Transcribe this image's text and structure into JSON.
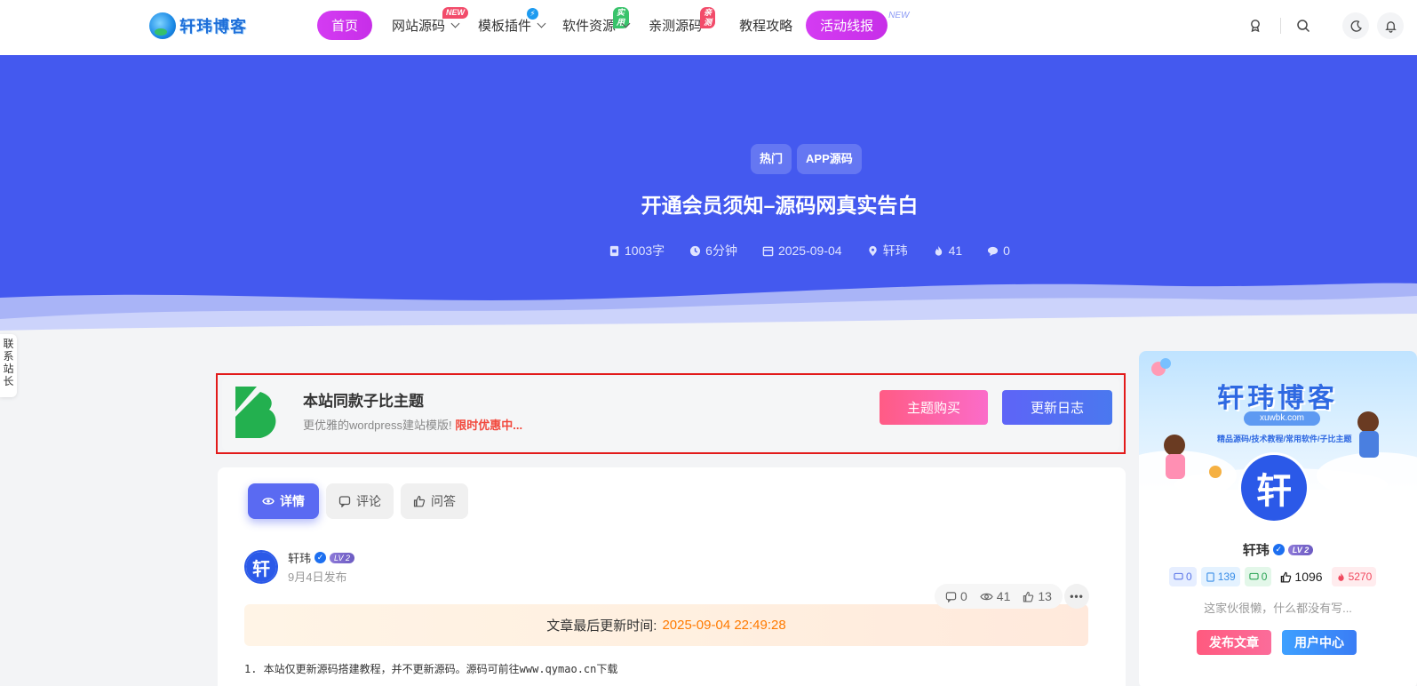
{
  "logo": {
    "text": "轩玮博客"
  },
  "nav": {
    "items": [
      {
        "label": "首页"
      },
      {
        "label": "网站源码",
        "badge": "NEW"
      },
      {
        "label": "模板插件",
        "badge": "⚡"
      },
      {
        "label": "软件资源",
        "badge": "实用"
      },
      {
        "label": "亲测源码",
        "badge": "亲测"
      },
      {
        "label": "教程攻略"
      },
      {
        "label": "活动线报",
        "badge": "NEW"
      }
    ]
  },
  "hero": {
    "tags": [
      "热门",
      "APP源码"
    ],
    "title": "开通会员须知–源码网真实告白",
    "meta": {
      "words": "1003字",
      "read_time": "6分钟",
      "date": "2025-09-04",
      "author": "轩玮",
      "views": "41",
      "comments": "0"
    }
  },
  "contact_tab": {
    "label": "联系站长"
  },
  "promo": {
    "title": "本站同款子比主题",
    "subtitle": "更优雅的wordpress建站模版!",
    "highlight": "限时优惠中...",
    "buy_label": "主题购买",
    "log_label": "更新日志"
  },
  "article": {
    "tabs": [
      "详情",
      "评论",
      "问答"
    ],
    "author": {
      "name": "轩玮",
      "level": "LV 2",
      "published": "9月4日发布",
      "avatar_char": "轩"
    },
    "stats": {
      "comments": "0",
      "views": "41",
      "likes": "13"
    },
    "update_label": "文章最后更新时间:",
    "update_time": "2025-09-04 22:49:28",
    "first_line": "1. 本站仅更新源码搭建教程，并不更新源码。源码可前往www.qymao.cn下载"
  },
  "sidebar": {
    "banner_title": "轩玮博客",
    "banner_url": "xuwbk.com",
    "banner_tagline": "精品源码/技术教程/常用软件/子比主题",
    "name": "轩玮",
    "level": "LV 2",
    "stats": {
      "comments": "0",
      "posts": "139",
      "replies": "0",
      "likes": "1096",
      "hot": "5270"
    },
    "bio": "这家伙很懒，什么都没有写...",
    "post_label": "发布文章",
    "center_label": "用户中心"
  },
  "colors": {
    "hero_bg": "#4459ef",
    "pill": "#d43cf2",
    "accent": "#5a6af2",
    "update_time": "#ff7a00",
    "highlight": "#f2483c",
    "outline": "#e21a1a"
  },
  "icons": [
    "award-icon",
    "search-icon",
    "moon-icon",
    "bell-icon",
    "doc-icon",
    "clock-icon",
    "calendar-icon",
    "location-icon",
    "fire-icon",
    "comment-icon",
    "eye-icon",
    "thumb-icon",
    "more-icon"
  ]
}
